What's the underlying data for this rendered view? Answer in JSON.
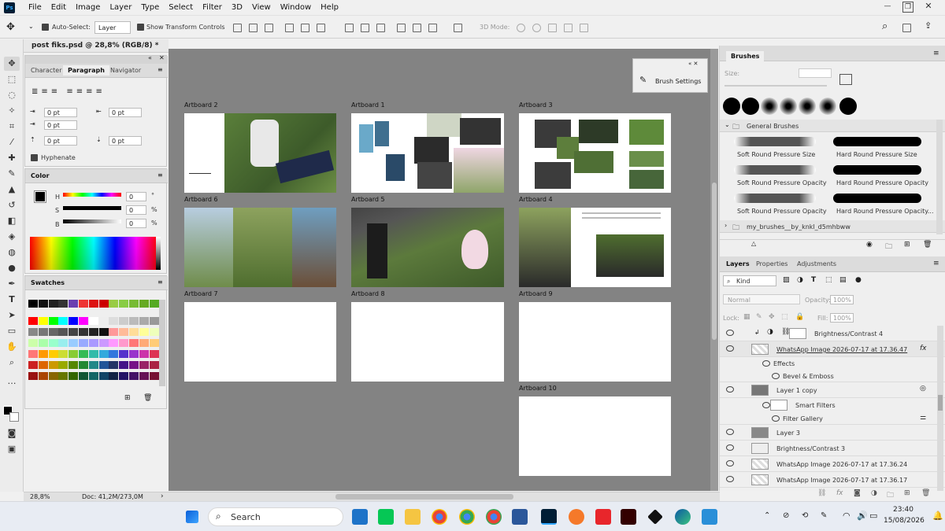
{
  "menu": {
    "items": [
      "File",
      "Edit",
      "Image",
      "Layer",
      "Type",
      "Select",
      "Filter",
      "3D",
      "View",
      "Window",
      "Help"
    ]
  },
  "options": {
    "autoselect_label": "Auto-Select:",
    "autoselect_value": "Layer",
    "show_transform": "Show Transform Controls",
    "mode3d": "3D Mode:"
  },
  "document": {
    "tab_title": "post fiks.psd @ 28,8% (RGB/8) *",
    "zoom": "28,8%",
    "doc_info": "Doc: 41,2M/273,0M"
  },
  "type_panel": {
    "tabs": [
      "Character",
      "Paragraph",
      "Navigator"
    ],
    "indent_left": "0 pt",
    "indent_right": "0 pt",
    "first_line": "0 pt",
    "space_before": "0 pt",
    "space_after": "0 pt",
    "hyphenate": "Hyphenate"
  },
  "color_panel": {
    "title": "Color",
    "h_label": "H",
    "s_label": "S",
    "b_label": "B",
    "h_value": "0",
    "s_value": "0",
    "b_value": "0",
    "deg": "°",
    "pct": "%"
  },
  "swatches_panel": {
    "title": "Swatches"
  },
  "brush_settings": {
    "label": "Brush Settings"
  },
  "artboards": [
    "Artboard 2",
    "Artboard 1",
    "Artboard 3",
    "Artboard 6",
    "Artboard 5",
    "Artboard 4",
    "Artboard 7",
    "Artboard 8",
    "Artboard 9",
    "Artboard 10"
  ],
  "brushes": {
    "title": "Brushes",
    "size_label": "Size:",
    "group1": "General Brushes",
    "items": [
      "Soft Round Pressure Size",
      "Hard Round Pressure Size",
      "Soft Round Pressure Opacity",
      "Hard Round Pressure Opacity",
      "Soft Round Pressure Opacity a...",
      "Hard Round Pressure Opacity..."
    ],
    "group2": "my_brushes__by_knkl_d5mhbww"
  },
  "layers": {
    "tabs": [
      "Layers",
      "Properties",
      "Adjustments"
    ],
    "kind": "Kind",
    "blend": "Normal",
    "opacity_label": "Opacity:",
    "opacity": "100%",
    "lock_label": "Lock:",
    "fill_label": "Fill:",
    "fill": "100%",
    "rows": [
      "Brightness/Contrast 4",
      "WhatsApp Image 2026-07-17 at 17.36.47",
      "Effects",
      "Bevel & Emboss",
      "Layer 1 copy",
      "Smart Filters",
      "Filter Gallery",
      "Layer 3",
      "Brightness/Contrast 3",
      "WhatsApp Image 2026-07-17 at 17.36.24",
      "WhatsApp Image 2026-07-17 at 17.36.17"
    ],
    "fx": "fx"
  },
  "taskbar": {
    "search": "Search",
    "time": "23:40",
    "date": "15/08/2026"
  },
  "colors": {
    "canvas": "#838383",
    "accent": "#31a8ff"
  }
}
